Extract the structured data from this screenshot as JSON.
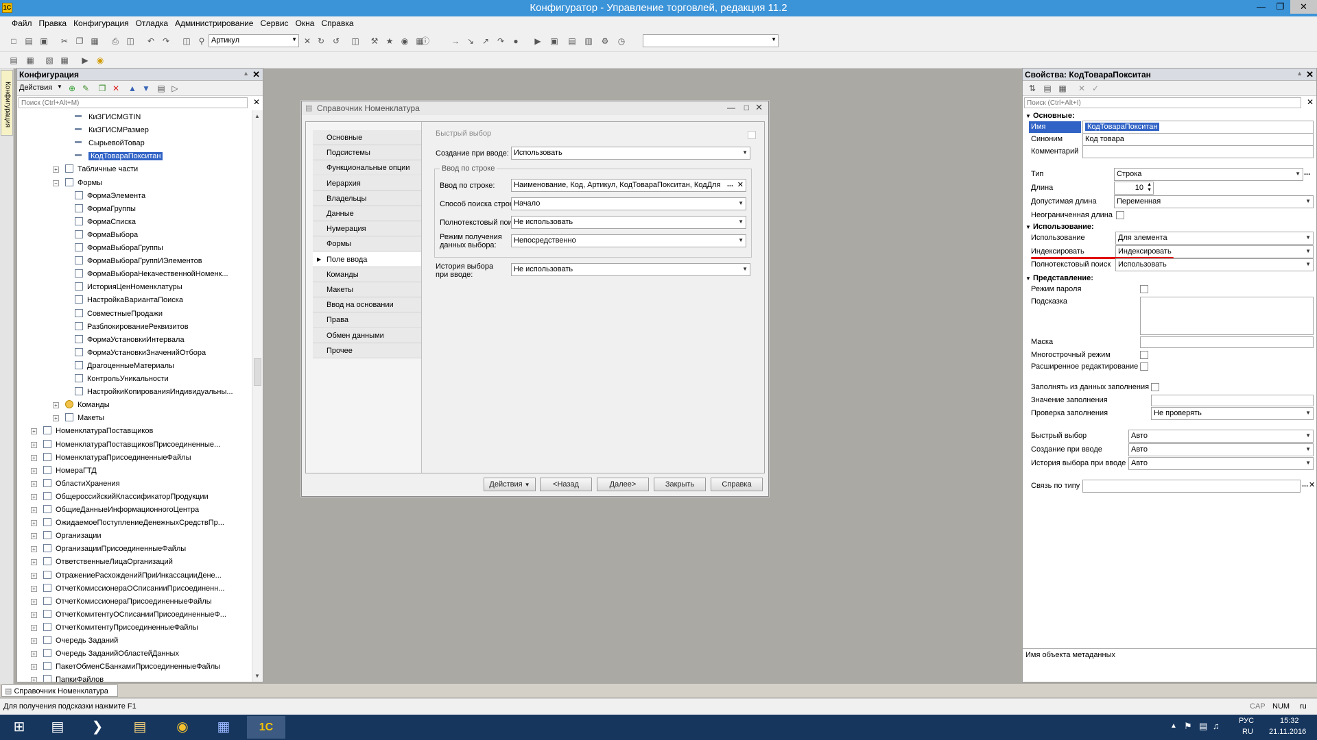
{
  "window": {
    "title": "Конфигуратор - Управление торговлей, редакция 11.2"
  },
  "menu": [
    "Файл",
    "Правка",
    "Конфигурация",
    "Отладка",
    "Администрирование",
    "Сервис",
    "Окна",
    "Справка"
  ],
  "toolbar": {
    "search_combo": "Артикул"
  },
  "config_panel": {
    "title": "Конфигурация",
    "actions_label": "Действия",
    "search_placeholder": "Поиск (Ctrl+Alt+M)",
    "side_tab": "Конфигурация",
    "tree": [
      {
        "label": "КиЗГИСМGTIN"
      },
      {
        "label": "КиЗГИСМРазмер"
      },
      {
        "label": "СырьевойТовар"
      },
      {
        "label": "КодТовараПокситан"
      },
      {
        "label": "Табличные части"
      },
      {
        "label": "Формы"
      },
      {
        "label": "ФормаЭлемента"
      },
      {
        "label": "ФормаГруппы"
      },
      {
        "label": "ФормаСписка"
      },
      {
        "label": "ФормаВыбора"
      },
      {
        "label": "ФормаВыбораГруппы"
      },
      {
        "label": "ФормаВыбораГруппИЭлементов"
      },
      {
        "label": "ФормаВыбораНекачественнойНоменк..."
      },
      {
        "label": "ИсторияЦенНоменклатуры"
      },
      {
        "label": "НастройкаВариантаПоиска"
      },
      {
        "label": "СовместныеПродажи"
      },
      {
        "label": "РазблокированиеРеквизитов"
      },
      {
        "label": "ФормаУстановкиИнтервала"
      },
      {
        "label": "ФормаУстановкиЗначенийОтбора"
      },
      {
        "label": "ДрагоценныеМатериалы"
      },
      {
        "label": "КонтрольУникальности"
      },
      {
        "label": "НастройкиКопированияИндивидуальны..."
      },
      {
        "label": "Команды"
      },
      {
        "label": "Макеты"
      },
      {
        "label": "НоменклатураПоставщиков"
      },
      {
        "label": "НоменклатураПоставщиковПрисоединенные..."
      },
      {
        "label": "НоменклатураПрисоединенныеФайлы"
      },
      {
        "label": "НомераГТД"
      },
      {
        "label": "ОбластиХранения"
      },
      {
        "label": "ОбщероссийскийКлассификаторПродукции"
      },
      {
        "label": "ОбщиеДанныеИнформационногоЦентра"
      },
      {
        "label": "ОжидаемоеПоступлениеДенежныхСредствПр..."
      },
      {
        "label": "Организации"
      },
      {
        "label": "ОрганизацииПрисоединенныеФайлы"
      },
      {
        "label": "ОтветственныеЛицаОрганизаций"
      },
      {
        "label": "ОтражениеРасхожденийПриИнкассацииДене..."
      },
      {
        "label": "ОтчетКомиссионераОСписанииПрисоединенн..."
      },
      {
        "label": "ОтчетКомиссионераПрисоединенныеФайлы"
      },
      {
        "label": "ОтчетКомитентуОСписанииПрисоединенныеФ..."
      },
      {
        "label": "ОтчетКомитентуПрисоединенныеФайлы"
      },
      {
        "label": "Очередь Заданий"
      },
      {
        "label": "Очередь ЗаданийОбластейДанных"
      },
      {
        "label": "ПакетОбменСБанкамиПрисоединенныеФайлы"
      },
      {
        "label": "ПапкиФайлов"
      }
    ]
  },
  "dialog": {
    "title": "Справочник Номенклатура",
    "tabs": [
      "Основные",
      "Подсистемы",
      "Функциональные опции",
      "Иерархия",
      "Владельцы",
      "Данные",
      "Нумерация",
      "Формы",
      "Поле ввода",
      "Команды",
      "Макеты",
      "Ввод на основании",
      "Права",
      "Обмен данными",
      "Прочее"
    ],
    "fast_select_label": "Быстрый выбор",
    "create_on_input_label": "Создание при вводе:",
    "create_on_input_value": "Использовать",
    "group_label": "Ввод по строке",
    "input_by_string_label": "Ввод по строке:",
    "input_by_string_value": "Наименование, Код, Артикул, КодТовараПокситан, КодДля",
    "search_mode_label": "Способ поиска строки:",
    "search_mode_value": "Начало",
    "fulltext_label": "Полнотекстовый поиск:",
    "fulltext_value": "Не использовать",
    "data_mode_label": "Режим получения данных выбора:",
    "data_mode_value": "Непосредственно",
    "history_label": "История выбора при вводе:",
    "history_value": "Не использовать",
    "buttons": {
      "actions": "Действия",
      "back": "<Назад",
      "next": "Далее>",
      "close": "Закрыть",
      "help": "Справка"
    }
  },
  "properties": {
    "title": "Свойства: КодТовараПокситан",
    "search_placeholder": "Поиск (Ctrl+Alt+I)",
    "sec_basic": "Основные:",
    "name_label": "Имя",
    "name_value": "КодТовараПокситан",
    "synonym_label": "Синоним",
    "synonym_value": "Код товара",
    "comment_label": "Комментарий",
    "type_label": "Тип",
    "type_value": "Строка",
    "length_label": "Длина",
    "length_value": "10",
    "allowed_length_label": "Допустимая длина",
    "allowed_length_value": "Переменная",
    "unlimited_label": "Неограниченная длина",
    "sec_usage": "Использование:",
    "usage_label": "Использование",
    "usage_value": "Для элемента",
    "index_label": "Индексировать",
    "index_value": "Индексировать",
    "fulltext_label": "Полнотекстовый поиск",
    "fulltext_value": "Использовать",
    "sec_view": "Представление:",
    "password_label": "Режим пароля",
    "hint_label": "Подсказка",
    "mask_label": "Маска",
    "multiline_label": "Многострочный режим",
    "extended_label": "Расширенное редактирование",
    "fill_from_label": "Заполнять из данных заполнения",
    "fill_value_label": "Значение заполнения",
    "fill_check_label": "Проверка заполнения",
    "fill_check_value": "Не проверять",
    "quick_select_label": "Быстрый выбор",
    "quick_select_value": "Авто",
    "create_label": "Создание при вводе",
    "create_value": "Авто",
    "history_label": "История выбора при вводе",
    "history_value": "Авто",
    "link_label": "Связь по типу",
    "description": "Имя объекта метаданных"
  },
  "window_tab": "Справочник Номенклатура",
  "status": {
    "hint": "Для получения подсказки нажмите F1",
    "cap": "CAP",
    "num": "NUM",
    "lang": "ru"
  },
  "taskbar": {
    "lang1": "РУС",
    "lang2": "RU",
    "time": "15:32",
    "date": "21.11.2016"
  },
  "colors": {
    "title_bar": "#3b93d8",
    "selection": "#3163c6",
    "underline": "#e00000",
    "taskbar": "#16365e"
  }
}
